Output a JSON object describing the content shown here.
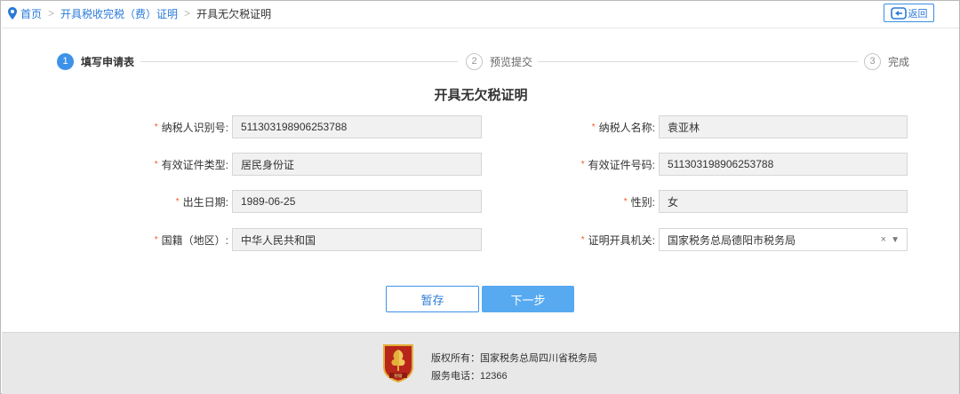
{
  "breadcrumb": {
    "home": "首页",
    "parent": "开具税收完税（费）证明",
    "current": "开具无欠税证明",
    "back": "返回"
  },
  "steps": [
    {
      "num": "1",
      "label": "填写申请表",
      "state": "active"
    },
    {
      "num": "2",
      "label": "预览提交",
      "state": "pending"
    },
    {
      "num": "3",
      "label": "完成",
      "state": "pending"
    }
  ],
  "form": {
    "title": "开具无欠税证明",
    "required_mark": "*",
    "fields": {
      "taxpayer_id": {
        "label": "纳税人识别号:",
        "value": "511303198906253788"
      },
      "taxpayer_name": {
        "label": "纳税人名称:",
        "value": "袁亚林"
      },
      "id_type": {
        "label": "有效证件类型:",
        "value": "居民身份证"
      },
      "id_number": {
        "label": "有效证件号码:",
        "value": "511303198906253788"
      },
      "birth_date": {
        "label": "出生日期:",
        "value": "1989-06-25"
      },
      "gender": {
        "label": "性别:",
        "value": "女"
      },
      "nationality": {
        "label": "国籍（地区）:",
        "value": "中华人民共和国"
      },
      "issuing_office": {
        "label": "证明开具机关:",
        "value": "国家税务总局德阳市税务局"
      }
    }
  },
  "buttons": {
    "save": "暂存",
    "next": "下一步"
  },
  "footer": {
    "copyright": "版权所有：国家税务总局四川省税务局",
    "service_phone": "服务电话：12366",
    "logo_text": "税徽"
  },
  "colors": {
    "accent": "#3d92e8",
    "required": "#f25a26",
    "next_button": "#58aaf0",
    "footer_bg": "#e8e8e8",
    "logo_red": "#b8251b",
    "logo_gold": "#e3b03a"
  }
}
